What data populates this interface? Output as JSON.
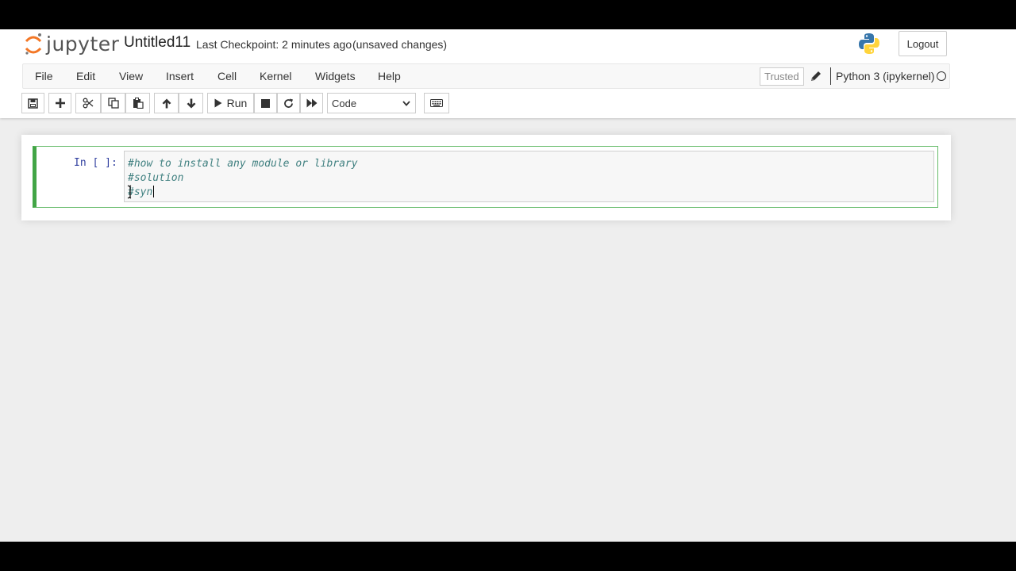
{
  "header": {
    "logo_text": "jupyter",
    "notebook_title": "Untitled11",
    "checkpoint": "Last Checkpoint: 2 minutes ago",
    "autosave_status": "(unsaved changes)",
    "logout_label": "Logout"
  },
  "menubar": {
    "items": [
      "File",
      "Edit",
      "View",
      "Insert",
      "Cell",
      "Kernel",
      "Widgets",
      "Help"
    ],
    "trusted_label": "Trusted",
    "kernel_name": "Python 3 (ipykernel)"
  },
  "toolbar": {
    "run_label": "Run",
    "cell_type": "Code",
    "cell_type_options": [
      "Code"
    ]
  },
  "cell": {
    "prompt": "In [ ]:",
    "lines": [
      "#how to install any module or library",
      "#solution",
      "#syn"
    ]
  },
  "colors": {
    "cell_border": "#42a546",
    "comment": "#408080",
    "prompt": "#303f9f",
    "background": "#eeeeee"
  }
}
